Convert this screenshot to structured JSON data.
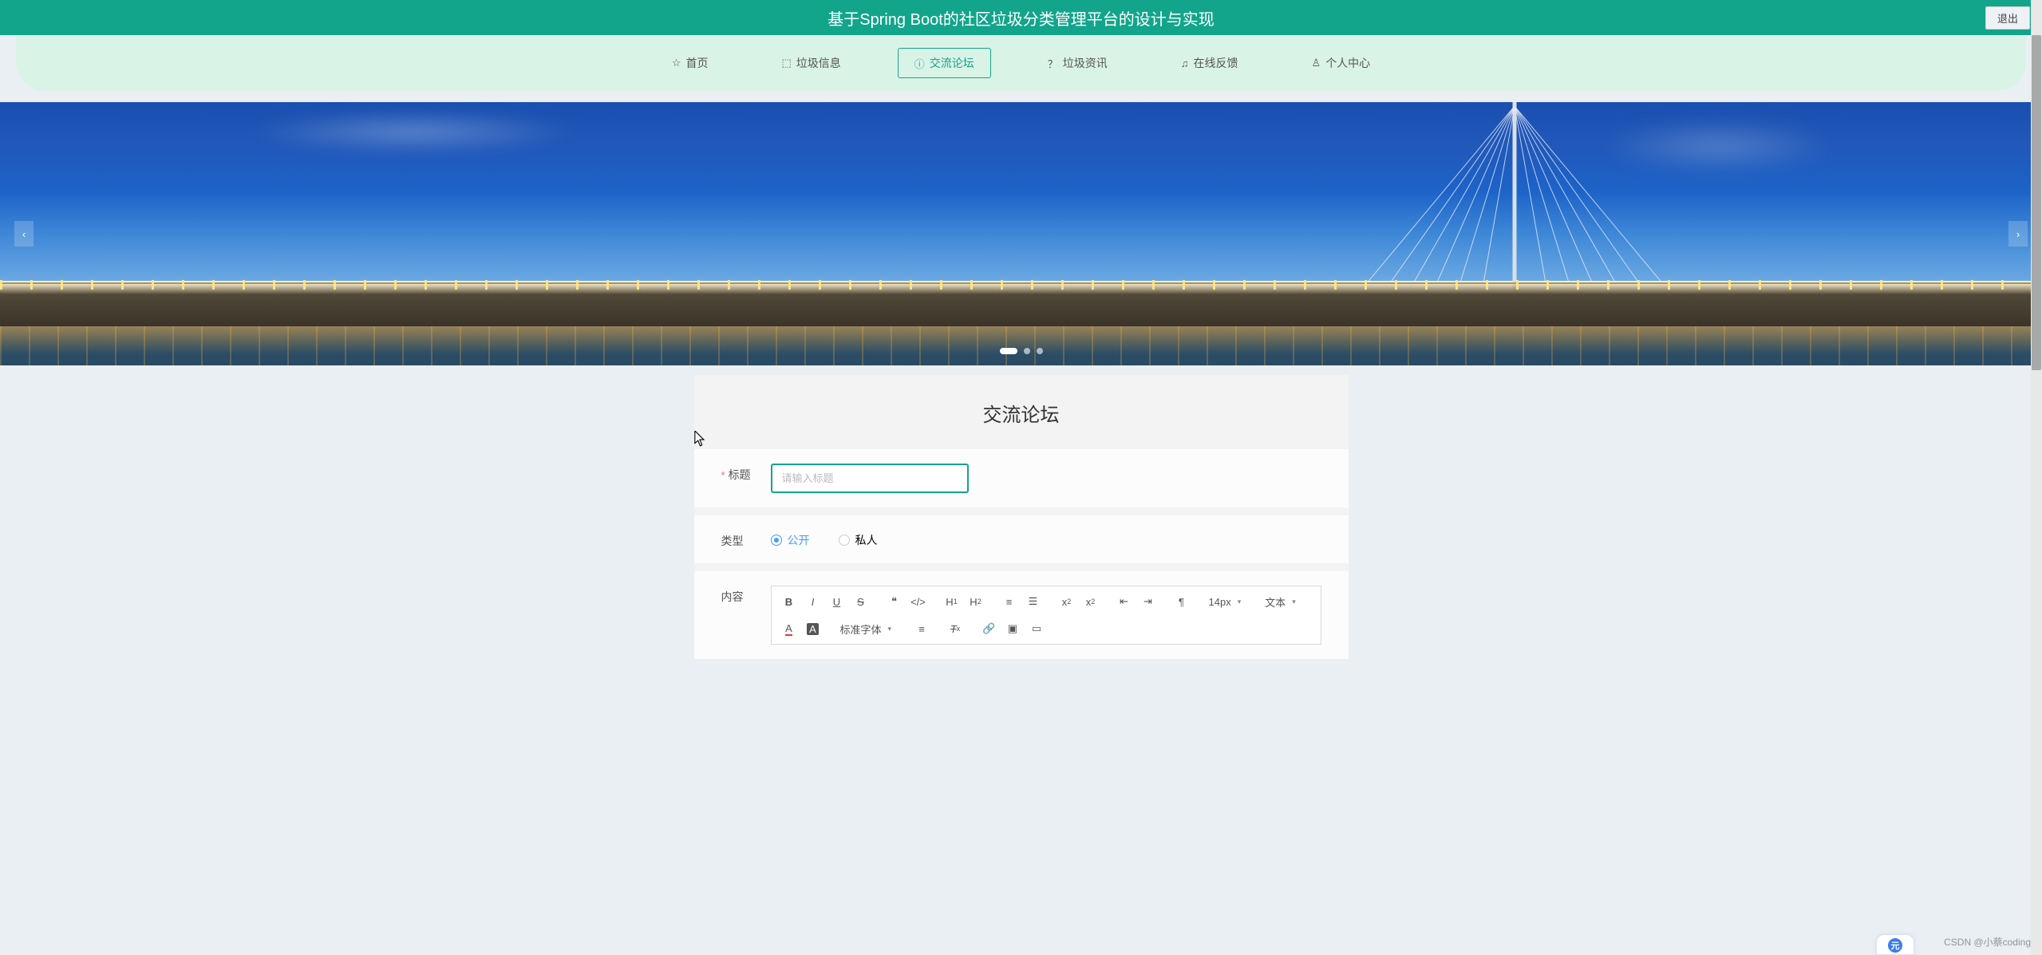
{
  "topbar": {
    "title": "基于Spring Boot的社区垃圾分类管理平台的设计与实现",
    "logout": "退出"
  },
  "nav": {
    "items": [
      {
        "icon": "star",
        "label": "首页"
      },
      {
        "icon": "box",
        "label": "垃圾信息"
      },
      {
        "icon": "info",
        "label": "交流论坛",
        "active": true
      },
      {
        "icon": "question",
        "label": "垃圾资讯"
      },
      {
        "icon": "headset",
        "label": "在线反馈"
      },
      {
        "icon": "user",
        "label": "个人中心"
      }
    ]
  },
  "form": {
    "title": "交流论坛",
    "title_label": "标题",
    "title_placeholder": "请输入标题",
    "type_label": "类型",
    "type_options": {
      "public": "公开",
      "private": "私人"
    },
    "content_label": "内容",
    "toolbar": {
      "font_size": "14px",
      "font_family": "标准字体",
      "block": "文本"
    }
  },
  "watermark": "CSDN @小蔡coding"
}
